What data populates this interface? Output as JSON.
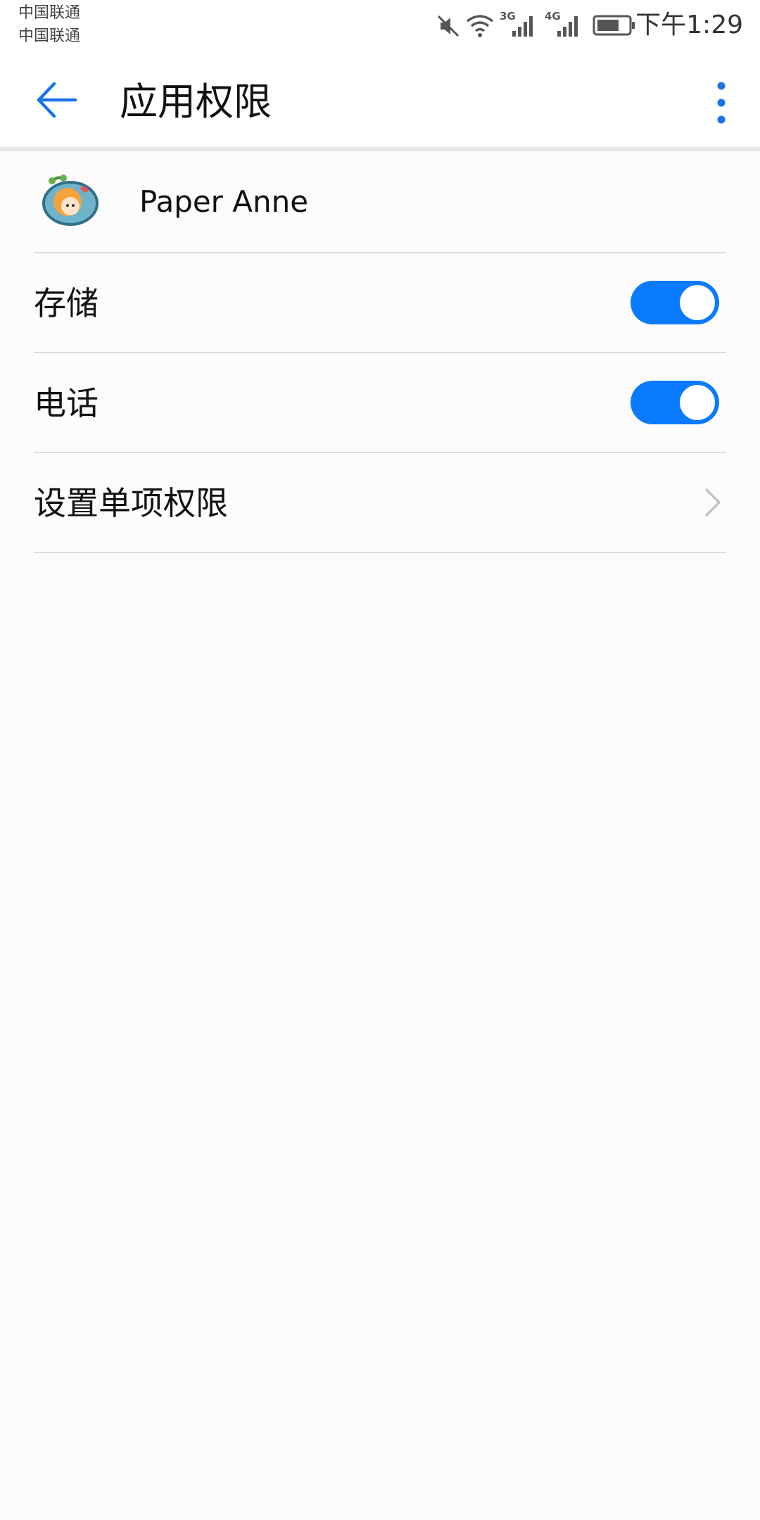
{
  "status_bar": {
    "carrier_1": "中国联通",
    "carrier_2": "中国联通",
    "network_1": "3G",
    "network_2": "4G",
    "time": "下午1:29",
    "icons": [
      "mute-icon",
      "wifi-icon",
      "signal-3g-icon",
      "signal-4g-icon",
      "battery-icon"
    ]
  },
  "app_bar": {
    "title": "应用权限",
    "back_icon": "back-arrow-icon",
    "more_icon": "more-vert-icon"
  },
  "app": {
    "name": "Paper Anne",
    "icon": "app-icon"
  },
  "permissions": [
    {
      "label": "存储",
      "enabled": true
    },
    {
      "label": "电话",
      "enabled": true
    }
  ],
  "individual_permissions": {
    "label": "设置单项权限",
    "icon": "chevron-right-icon"
  },
  "colors": {
    "accent": "#0a7aff",
    "back_arrow": "#1a73e8",
    "divider": "#dcdcdc",
    "background": "#fcfcfc"
  }
}
